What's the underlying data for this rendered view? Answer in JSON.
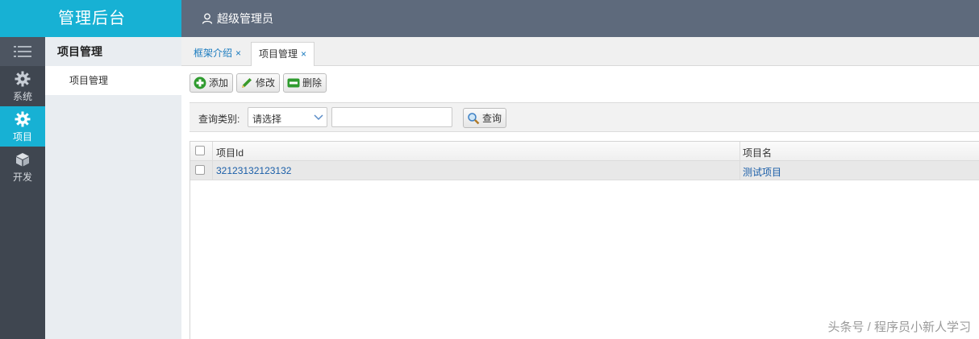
{
  "header": {
    "brand": "管理后台",
    "user": "超级管理员"
  },
  "rail": {
    "items": [
      {
        "label": "系统",
        "icon": "gear-icon"
      },
      {
        "label": "项目",
        "icon": "gear-icon",
        "active": true
      },
      {
        "label": "开发",
        "icon": "cube-icon"
      }
    ]
  },
  "sidebar": {
    "title": "项目管理",
    "items": [
      {
        "label": "项目管理"
      }
    ]
  },
  "tabs": [
    {
      "label": "框架介绍",
      "close": "×"
    },
    {
      "label": "项目管理",
      "close": "×",
      "active": true
    }
  ],
  "toolbar": {
    "add": "添加",
    "edit": "修改",
    "delete": "删除"
  },
  "query": {
    "label": "查询类别:",
    "select_value": "请选择",
    "input_value": "",
    "button": "查询"
  },
  "grid": {
    "columns": [
      "项目Id",
      "项目名"
    ],
    "rows": [
      [
        "32123132123132",
        "测试项目"
      ]
    ]
  },
  "watermark": "头条号 / 程序员小新人学习",
  "colors": {
    "accent": "#17b1d4",
    "topbar": "#5e6a7c",
    "rail": "#3f4650",
    "link": "#1a7bbf"
  }
}
